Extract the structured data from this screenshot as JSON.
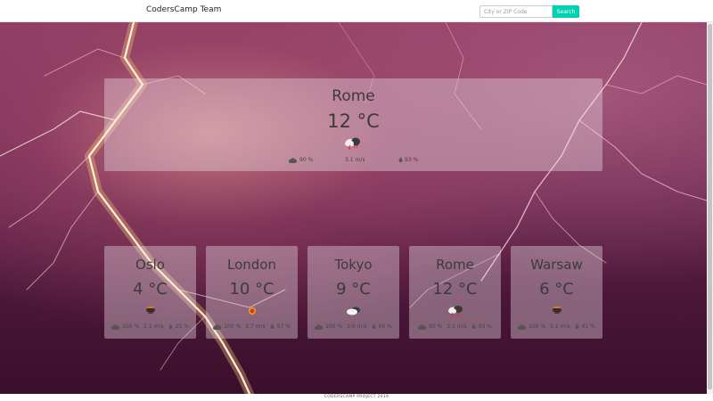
{
  "navbar": {
    "brand": "CodersCamp Team",
    "search_placeholder": "City or ZIP Code",
    "search_button": "Search"
  },
  "main_card": {
    "city": "Rome",
    "temperature": "12 °C",
    "icon": "thunderstorm-rain-icon",
    "clouds": "90 %",
    "wind": "3.1 m/s",
    "humidity": "93 %"
  },
  "cards": [
    {
      "city": "Oslo",
      "temperature": "4 °C",
      "icon": "mist-icon",
      "clouds": "100 %",
      "wind": "2.1 m/s",
      "humidity": "25 %"
    },
    {
      "city": "London",
      "temperature": "10 °C",
      "icon": "sun-icon",
      "clouds": "100 %",
      "wind": "3.7 m/s",
      "humidity": "57 %"
    },
    {
      "city": "Tokyo",
      "temperature": "9 °C",
      "icon": "cloud-sun-icon",
      "clouds": "100 %",
      "wind": "3.6 m/s",
      "humidity": "66 %"
    },
    {
      "city": "Rome",
      "temperature": "12 °C",
      "icon": "thunderstorm-rain-icon",
      "clouds": "90 %",
      "wind": "3.1 m/s",
      "humidity": "93 %"
    },
    {
      "city": "Warsaw",
      "temperature": "6 °C",
      "icon": "mist-icon",
      "clouds": "100 %",
      "wind": "5.1 m/s",
      "humidity": "41 %"
    }
  ],
  "footer": {
    "text": "CODERSCAMP PROJECT 2019"
  },
  "colors": {
    "accent": "#00d1b2",
    "card_bg": "rgba(240,225,235,0.38)",
    "background": "#6b2750"
  }
}
